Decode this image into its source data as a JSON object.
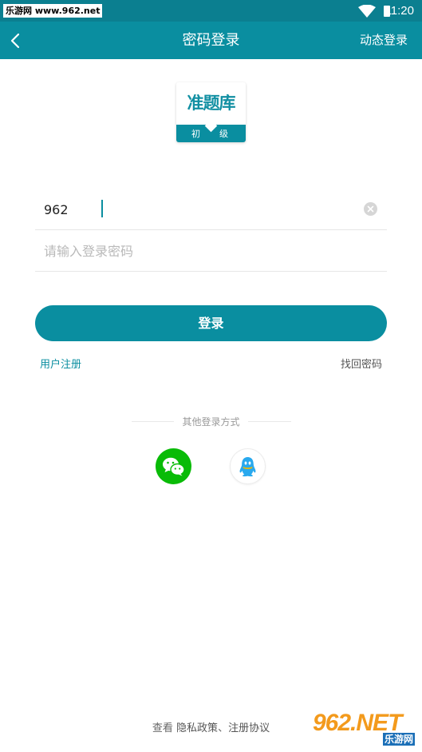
{
  "status_bar": {
    "badge_text": "乐游网 www.962.net",
    "time": "11:20"
  },
  "app_bar": {
    "title": "密码登录",
    "action_label": "动态登录",
    "back_icon": "chevron-left-icon"
  },
  "logo": {
    "title": "准题库",
    "sub_a": "初",
    "sub_b": "级"
  },
  "form": {
    "username_value": "962",
    "password_placeholder": "请输入登录密码",
    "login_label": "登录",
    "register_link": "用户注册",
    "forgot_link": "找回密码"
  },
  "other_login": {
    "label": "其他登录方式",
    "options": [
      "wechat-icon",
      "qq-icon"
    ]
  },
  "footer": {
    "prefix": "查看 ",
    "privacy_link": "隐私政策",
    "separator": "、",
    "agreement_link": "注册协议"
  },
  "watermark": {
    "main": "962.NET",
    "sub": "乐游网"
  },
  "colors": {
    "primary": "#0a8ea0",
    "status_bar": "#0b7f90",
    "wechat": "#09bb07",
    "qq": "#29a9ee"
  }
}
